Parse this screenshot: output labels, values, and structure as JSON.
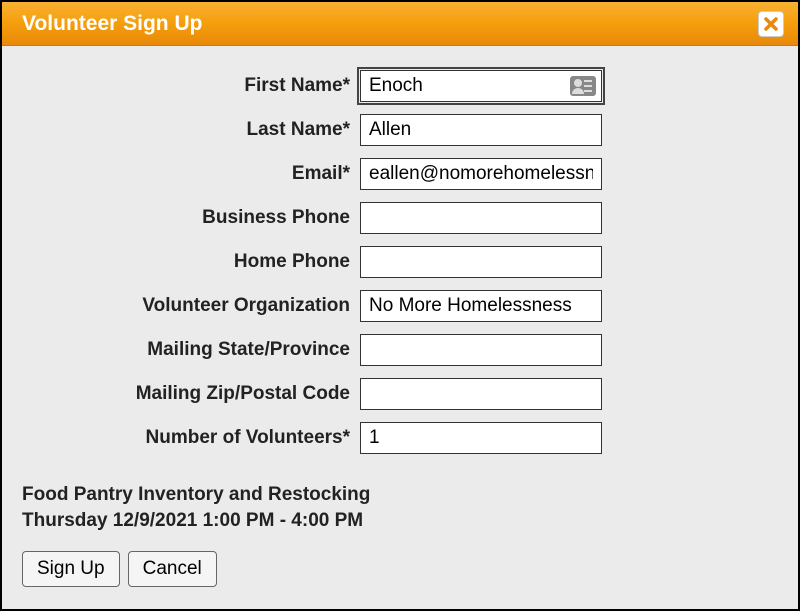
{
  "header": {
    "title": "Volunteer Sign Up"
  },
  "form": {
    "first_name": {
      "label": "First Name*",
      "value": "Enoch"
    },
    "last_name": {
      "label": "Last Name*",
      "value": "Allen"
    },
    "email": {
      "label": "Email*",
      "value": "eallen@nomorehomelessness.org"
    },
    "business_phone": {
      "label": "Business Phone",
      "value": ""
    },
    "home_phone": {
      "label": "Home Phone",
      "value": ""
    },
    "volunteer_org": {
      "label": "Volunteer Organization",
      "value": "No More Homelessness"
    },
    "mailing_state": {
      "label": "Mailing State/Province",
      "value": ""
    },
    "mailing_zip": {
      "label": "Mailing Zip/Postal Code",
      "value": ""
    },
    "num_volunteers": {
      "label": "Number of Volunteers*",
      "value": "1"
    }
  },
  "event": {
    "name": "Food Pantry Inventory and Restocking",
    "datetime": "Thursday 12/9/2021 1:00 PM - 4:00 PM"
  },
  "buttons": {
    "signup": "Sign Up",
    "cancel": "Cancel"
  }
}
